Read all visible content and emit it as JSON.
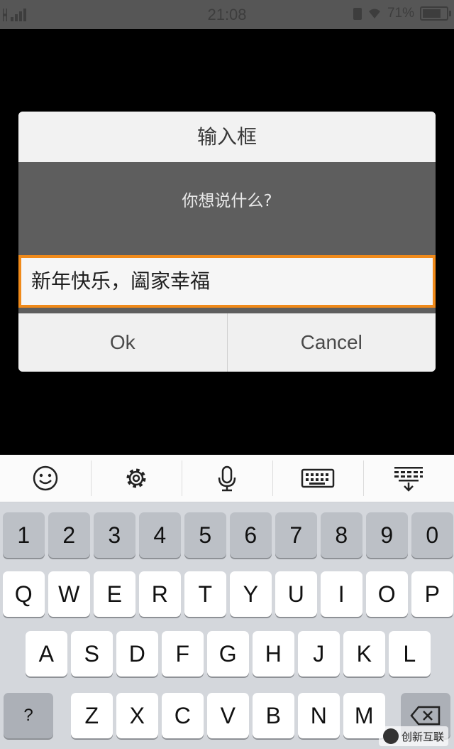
{
  "status_bar": {
    "time": "21:08",
    "battery": "71%"
  },
  "dialog": {
    "title": "输入框",
    "message": "你想说什么?",
    "input_value": "新年快乐，阖家幸福",
    "ok_label": "Ok",
    "cancel_label": "Cancel"
  },
  "keyboard": {
    "toolbar_icons": [
      "smiley-icon",
      "gear-icon",
      "microphone-icon",
      "keyboard-icon",
      "collapse-keyboard-icon"
    ],
    "number_row": [
      "1",
      "2",
      "3",
      "4",
      "5",
      "6",
      "7",
      "8",
      "9",
      "0"
    ],
    "row1": [
      "Q",
      "W",
      "E",
      "R",
      "T",
      "Y",
      "U",
      "I",
      "O",
      "P"
    ],
    "row2": [
      "A",
      "S",
      "D",
      "F",
      "G",
      "H",
      "J",
      "K",
      "L"
    ],
    "row3": [
      "Z",
      "X",
      "C",
      "V",
      "B",
      "N",
      "M"
    ],
    "symbol_key": "?"
  },
  "watermark": {
    "text": "创新互联"
  },
  "colors": {
    "input_border": "#f08a1a",
    "dialog_body": "#5e5e5e",
    "dialog_header": "#f2f2f2"
  }
}
